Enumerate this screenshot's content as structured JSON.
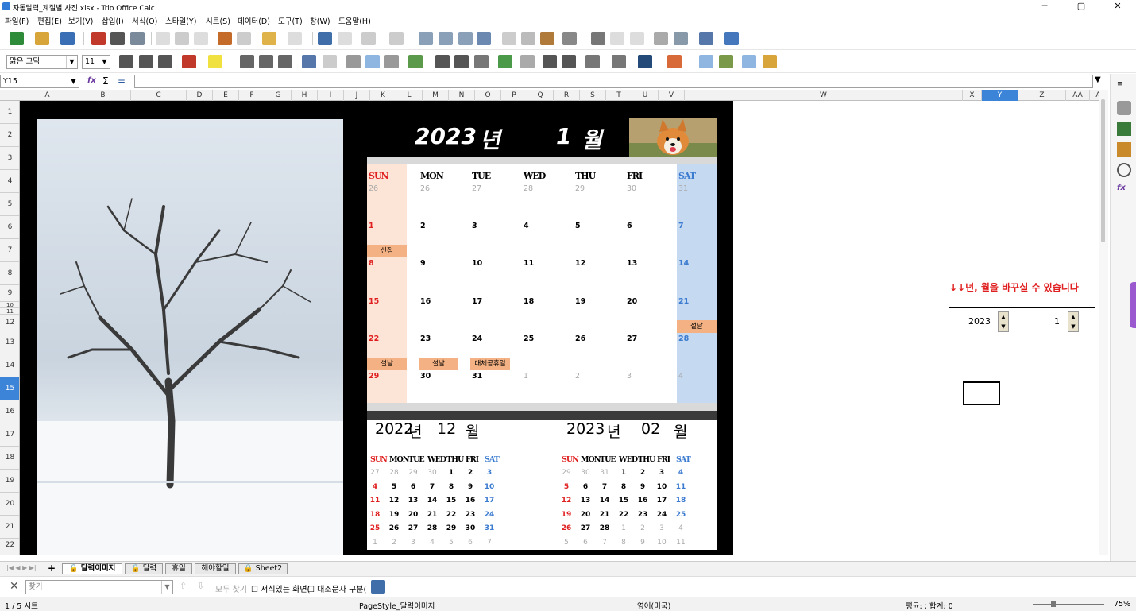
{
  "window": {
    "title": "자동달력_계절별 사진.xlsx - Trio Office Calc",
    "minimize": "─",
    "maximize": "▢",
    "close": "✕"
  },
  "menu": [
    "파일(F)",
    "편집(E)",
    "보기(V)",
    "삽입(I)",
    "서식(O)",
    "스타일(Y)",
    "시트(S)",
    "데이터(D)",
    "도구(T)",
    "창(W)",
    "도움말(H)"
  ],
  "format_toolbar": {
    "font_name": "맑은 고딕",
    "font_size": "11"
  },
  "formula_bar": {
    "cell_ref": "Y15",
    "formula": ""
  },
  "columns": [
    "A",
    "B",
    "C",
    "D",
    "E",
    "F",
    "G",
    "H",
    "I",
    "J",
    "K",
    "L",
    "M",
    "N",
    "O",
    "P",
    "Q",
    "R",
    "S",
    "T",
    "U",
    "V",
    "W",
    "X",
    "Y",
    "Z",
    "AA",
    "AB"
  ],
  "rows": [
    "1",
    "2",
    "3",
    "4",
    "5",
    "6",
    "7",
    "8",
    "9",
    "10",
    "11",
    "12",
    "13",
    "14",
    "15",
    "16",
    "17",
    "18",
    "19",
    "20",
    "21",
    "22"
  ],
  "active_cell": {
    "col": "Y",
    "row": "15"
  },
  "main_calendar": {
    "year": "2023",
    "year_unit": "년",
    "month": "1",
    "month_unit": "월",
    "weekdays": [
      "SUN",
      "MON",
      "TUE",
      "WED",
      "THU",
      "FRI",
      "SAT"
    ],
    "weeks": [
      [
        "26",
        "26",
        "27",
        "28",
        "29",
        "30",
        "31"
      ],
      [
        "1",
        "2",
        "3",
        "4",
        "5",
        "6",
        "7"
      ],
      [
        "8",
        "9",
        "10",
        "11",
        "12",
        "13",
        "14"
      ],
      [
        "15",
        "16",
        "17",
        "18",
        "19",
        "20",
        "21"
      ],
      [
        "22",
        "23",
        "24",
        "25",
        "26",
        "27",
        "28"
      ],
      [
        "29",
        "30",
        "31",
        "1",
        "2",
        "3",
        "4"
      ]
    ],
    "holidays": {
      "sinjeong": "신정",
      "seollal1": "설날",
      "seollal2": "설날",
      "seollal3": "설날",
      "daechae": "대체공휴일"
    }
  },
  "prev_calendar": {
    "year": "2022",
    "year_unit": "년",
    "month": "12",
    "month_unit": "월",
    "weekdays": [
      "SUN",
      "MON",
      "TUE",
      "WED",
      "THU",
      "FRI",
      "SAT"
    ],
    "weeks": [
      [
        "27",
        "28",
        "29",
        "30",
        "1",
        "2",
        "3"
      ],
      [
        "4",
        "5",
        "6",
        "7",
        "8",
        "9",
        "10"
      ],
      [
        "11",
        "12",
        "13",
        "14",
        "15",
        "16",
        "17"
      ],
      [
        "18",
        "19",
        "20",
        "21",
        "22",
        "23",
        "24"
      ],
      [
        "25",
        "26",
        "27",
        "28",
        "29",
        "30",
        "31"
      ],
      [
        "1",
        "2",
        "3",
        "4",
        "5",
        "6",
        "7"
      ]
    ]
  },
  "next_calendar": {
    "year": "2023",
    "year_unit": "년",
    "month": "02",
    "month_unit": "월",
    "weekdays": [
      "SUN",
      "MON",
      "TUE",
      "WED",
      "THU",
      "FRI",
      "SAT"
    ],
    "weeks": [
      [
        "29",
        "30",
        "31",
        "1",
        "2",
        "3",
        "4"
      ],
      [
        "5",
        "6",
        "7",
        "8",
        "9",
        "10",
        "11"
      ],
      [
        "12",
        "13",
        "14",
        "15",
        "16",
        "17",
        "18"
      ],
      [
        "19",
        "20",
        "21",
        "22",
        "23",
        "24",
        "25"
      ],
      [
        "26",
        "27",
        "28",
        "1",
        "2",
        "3",
        "4"
      ],
      [
        "5",
        "6",
        "7",
        "8",
        "9",
        "10",
        "11"
      ]
    ]
  },
  "notice": "↓↓년, 월을 바꾸실 수 있습니다",
  "spinner": {
    "year": "2023",
    "month": "1"
  },
  "sheet_tabs": [
    "달력이미지",
    "달력",
    "휴일",
    "해야할일",
    "Sheet2"
  ],
  "active_tab": "달력이미지",
  "findbar": {
    "placeholder": "찾기",
    "find_all": "모두 찾기",
    "formatted_display": "서식있는 화면(",
    "match_case": "대소문자 구분("
  },
  "status": {
    "sheet": "1 / 5 시트",
    "page_style": "PageStyle_달력이미지",
    "language": "영어(미국)",
    "summary": "평균: ; 합계: 0",
    "zoom": "75%"
  },
  "colors": {
    "black": "#000000",
    "sun_bg": "#fce4d6",
    "sat_bg": "#c5d9f1",
    "holiday": "#f4b183",
    "red": "#e02020",
    "blue": "#3b7bd0",
    "active_header": "#3c84d8"
  }
}
